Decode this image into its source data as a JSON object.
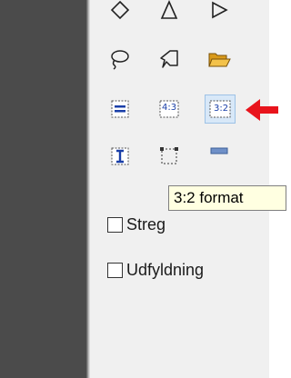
{
  "tools": {
    "row1": [
      "diamond-shape-icon",
      "triangle-shape-icon",
      "play-shape-icon"
    ],
    "row2": [
      "lasso-icon",
      "pin-shape-icon",
      "open-folder-icon"
    ],
    "row3": [
      "equals-format-icon",
      "format-4-3-icon",
      "format-3-2-icon"
    ],
    "row3_labels": {
      "four_three": "4:3",
      "three_two": "3:2"
    },
    "row4": [
      "text-cursor-icon",
      "selection-box-icon",
      "fill-swatch-icon"
    ]
  },
  "tooltip": {
    "text": "3:2 format"
  },
  "checkboxes": [
    {
      "label": "Streg",
      "checked": false
    },
    {
      "label": "Udfyldning",
      "checked": false
    }
  ],
  "colors": {
    "accent": "#e8141c",
    "selected_bg": "#d8e8f8",
    "tooltip_bg": "#ffffe1"
  }
}
